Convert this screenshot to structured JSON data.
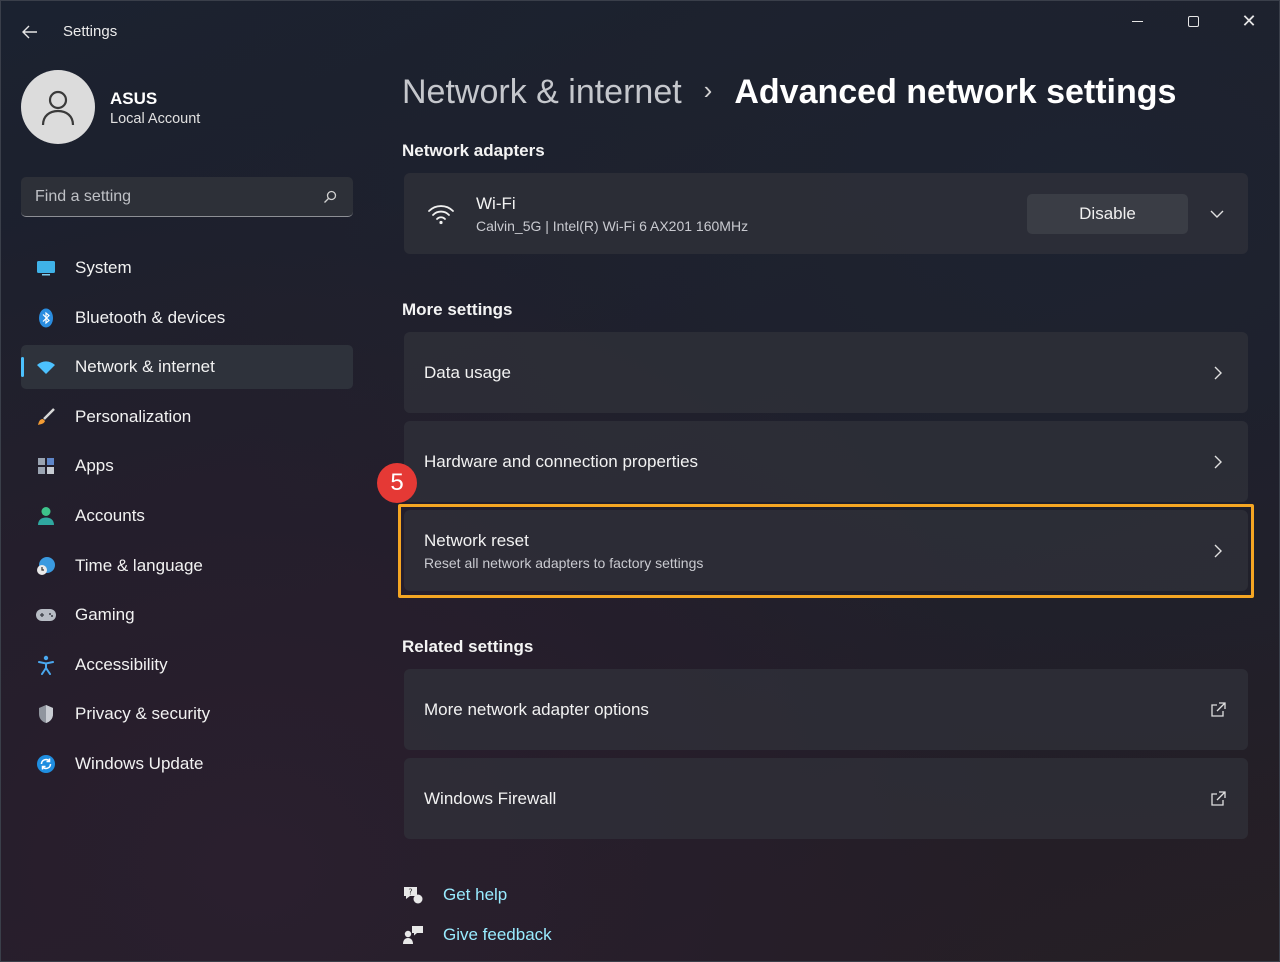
{
  "window": {
    "title": "Settings"
  },
  "profile": {
    "name": "ASUS",
    "account_type": "Local Account"
  },
  "search": {
    "placeholder": "Find a setting"
  },
  "sidebar": {
    "items": [
      {
        "label": "System",
        "icon": "system-icon",
        "active": false
      },
      {
        "label": "Bluetooth & devices",
        "icon": "bluetooth-icon",
        "active": false
      },
      {
        "label": "Network & internet",
        "icon": "wifi-icon",
        "active": true
      },
      {
        "label": "Personalization",
        "icon": "brush-icon",
        "active": false
      },
      {
        "label": "Apps",
        "icon": "apps-icon",
        "active": false
      },
      {
        "label": "Accounts",
        "icon": "person-icon",
        "active": false
      },
      {
        "label": "Time & language",
        "icon": "globe-clock-icon",
        "active": false
      },
      {
        "label": "Gaming",
        "icon": "gamepad-icon",
        "active": false
      },
      {
        "label": "Accessibility",
        "icon": "accessibility-icon",
        "active": false
      },
      {
        "label": "Privacy & security",
        "icon": "shield-icon",
        "active": false
      },
      {
        "label": "Windows Update",
        "icon": "update-icon",
        "active": false
      }
    ]
  },
  "breadcrumb": {
    "parent": "Network & internet",
    "separator": "›",
    "current": "Advanced network settings"
  },
  "sections": {
    "adapters_title": "Network adapters",
    "more_title": "More settings",
    "related_title": "Related settings"
  },
  "adapter": {
    "name": "Wi-Fi",
    "details": "Calvin_5G | Intel(R) Wi-Fi 6 AX201 160MHz",
    "button_label": "Disable"
  },
  "more_settings": {
    "data_usage": "Data usage",
    "hardware": "Hardware and connection properties",
    "network_reset": "Network reset",
    "network_reset_desc": "Reset all network adapters to factory settings"
  },
  "related_settings": {
    "adapter_options": "More network adapter options",
    "firewall": "Windows Firewall"
  },
  "help": {
    "get_help": "Get help",
    "give_feedback": "Give feedback"
  },
  "annotation": {
    "step_number": "5",
    "highlight_color": "#f5a623",
    "badge_color": "#e53935"
  },
  "colors": {
    "accent": "#4cc2ff",
    "link": "#99ebff"
  }
}
